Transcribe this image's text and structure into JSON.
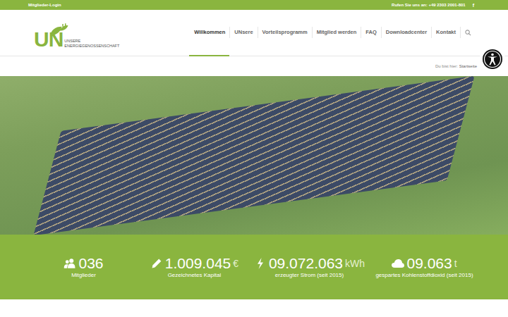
{
  "topbar": {
    "login": "Mitglieder-Login",
    "phone_label": "Rufen Sie uns an:",
    "phone": "+49 2303 2001-801",
    "social": "f"
  },
  "logo": {
    "mark": "UN",
    "line1": "UNSERE",
    "line2": "ENERGIEGENOSSENSCHAFT"
  },
  "nav": [
    {
      "label": "Willkommen",
      "selected": true
    },
    {
      "label": "UNsere",
      "selected": false
    },
    {
      "label": "Vorteilsprogramm",
      "selected": false
    },
    {
      "label": "Mitglied werden",
      "selected": false
    },
    {
      "label": "FAQ",
      "selected": false
    },
    {
      "label": "Downloadcenter",
      "selected": false
    },
    {
      "label": "Kontakt",
      "selected": false
    }
  ],
  "breadcrumb": {
    "label": "Du bist hier:",
    "current": "Startseite"
  },
  "stats": [
    {
      "kind": "members",
      "value": "036",
      "unit": "",
      "label": "Mitglieder"
    },
    {
      "kind": "capital",
      "value": "1.009.045",
      "unit": "€",
      "label": "Gezeichnetes Kapital"
    },
    {
      "kind": "power",
      "value": "09.072.063",
      "unit": "kWh",
      "label": "erzeugter Strom (seit 2015)"
    },
    {
      "kind": "co2",
      "value": "09.063",
      "unit": "t",
      "label": "gespartes Kohlenstoffdioxid (seit 2015)"
    }
  ]
}
